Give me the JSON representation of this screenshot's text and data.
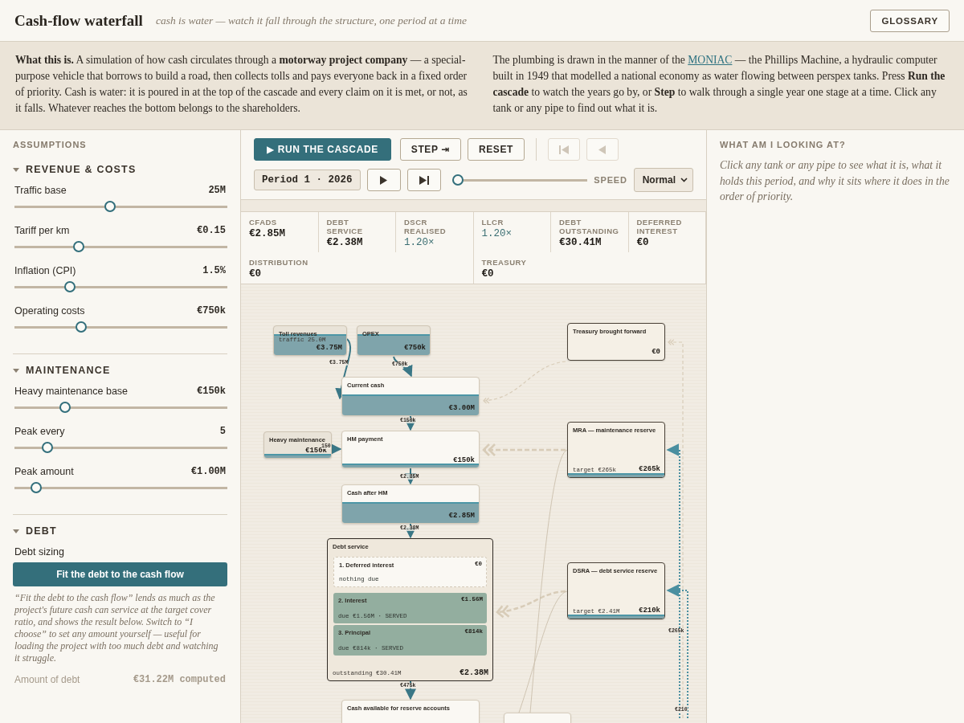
{
  "header": {
    "title": "Cash-flow waterfall",
    "subtitle": "cash is water — watch it fall through the structure, one period at a time",
    "button": "GLOSSARY"
  },
  "intro": {
    "left": "**What this is.** A simulation of how cash circulates through a **motorway project company** — a special-purpose vehicle that borrows to build a road, then collects tolls and pays everyone back in a fixed order of priority. Cash is water: it is poured in at the top of the cascade and every claim on it is met, or not, as it falls. Whatever reaches the bottom belongs to the shareholders.",
    "right_before": "The plumbing is drawn in the manner of the",
    "right_link": "MONIAC",
    "right_after": "— the Phillips Machine, a hydraulic computer built in 1949 that modelled a national economy as water flowing between perspex tanks. Press **Run the cascade** to watch the years go by, or **Step** to walk through a single year one stage at a time. Click any tank or any pipe to find out what it is."
  },
  "sidebar": {
    "title": "ASSUMPTIONS",
    "sections": [
      {
        "title": "REVENUE & COSTS",
        "expanded": true,
        "sliders": [
          {
            "label": "Traffic base",
            "reading": "25M",
            "level": 0.45
          },
          {
            "label": "Tariff per km",
            "reading": "€0.15",
            "level": 0.3
          },
          {
            "label": "Inflation (CPI)",
            "reading": "1.5%",
            "level": 0.26
          },
          {
            "label": "Operating costs",
            "reading": "€750k",
            "level": 0.315
          }
        ]
      },
      {
        "title": "MAINTENANCE",
        "expanded": true,
        "sliders": [
          {
            "label": "Heavy maintenance base",
            "reading": "€150k",
            "level": 0.237
          },
          {
            "label": "Peak every",
            "reading": "5",
            "level": 0.155
          },
          {
            "label": "Peak amount",
            "reading": "€1.00M",
            "level": 0.1
          }
        ]
      },
      {
        "title": "DEBT",
        "expanded": true,
        "field_label": "Debt sizing",
        "button": "Fit the debt to the cash flow",
        "note": "“Fit the debt to the cash flow” lends as much as the project's future cash can service at the target cover ratio, and shows the result below. Switch to “I choose” to set any amount yourself — useful for loading the project with too much debt and watching it struggle.",
        "amount": {
          "label": "Amount of debt",
          "value": "€31.22M computed",
          "disabled": true
        }
      }
    ]
  },
  "controls": {
    "buttons": [
      {
        "label": "▶ RUN THE CASCADE",
        "kind": "primary"
      },
      {
        "label": "STEP ⇥",
        "kind": "plain"
      },
      {
        "label": "RESET",
        "kind": "plain"
      }
    ],
    "nav": [
      {
        "kind": "first",
        "disabled": true
      },
      {
        "kind": "back",
        "disabled": true
      }
    ],
    "period": "Period 1 · 2026",
    "player": [
      {
        "kind": "play",
        "disabled": false
      },
      {
        "kind": "end",
        "disabled": false
      }
    ],
    "timeline": {
      "level": 0
    },
    "speed_label": "SPEED",
    "speed": "Normal"
  },
  "metrics": [
    {
      "label": "CFADS",
      "value": "€2.85M",
      "highlight": false
    },
    {
      "label": "DEBT SERVICE",
      "value": "€2.38M",
      "highlight": false
    },
    {
      "label": "DSCR REALISED",
      "value": "1.20×",
      "highlight": true
    },
    {
      "label": "LLCR",
      "value": "1.20×",
      "highlight": true
    },
    {
      "label": "DEBT OUTSTANDING",
      "value": "€30.41M",
      "highlight": false
    },
    {
      "label": "DEFERRED INTEREST",
      "value": "€0",
      "highlight": false
    },
    {
      "label": "DISTRIBUTION",
      "value": "€0",
      "highlight": false
    },
    {
      "label": "TREASURY",
      "value": "€0",
      "highlight": false
    }
  ],
  "diagram": {
    "tanks": [
      {
        "kind": "input",
        "title": "Toll revenues",
        "value": "€3.75M",
        "note": "traffic 25.0M",
        "filled": true,
        "waterline": true
      },
      {
        "kind": "input",
        "title": "OPEX",
        "value": "€750k",
        "filled": true,
        "waterline": true
      },
      {
        "kind": "reserve",
        "title": "Treasury brought forward",
        "value": "€0",
        "filled": false,
        "waterline": false
      },
      {
        "kind": "tank",
        "title": "Current cash",
        "value": "€3.00M",
        "filled": true,
        "waterline": true
      },
      {
        "kind": "input",
        "title": "Heavy maintenance",
        "value": "€150k",
        "filled": false,
        "waterline": true
      },
      {
        "kind": "tank",
        "title": "HM payment",
        "value": "€150k",
        "filled": false,
        "waterline": true
      },
      {
        "kind": "reserve",
        "title": "MRA — maintenance reserve",
        "value": "€265k",
        "note": "target €265k",
        "filled": false,
        "waterline": true
      },
      {
        "kind": "tank",
        "title": "Cash after HM",
        "value": "€2.85M",
        "filled": true,
        "waterline": true
      },
      {
        "kind": "reserve",
        "title": "DSRA — debt service reserve",
        "value": "€210k",
        "note": "target €2.41M",
        "filled": false,
        "waterline": true
      },
      {
        "kind": "tank",
        "title": "Cash available for reserve accounts",
        "filled": false,
        "waterline": false
      },
      {
        "kind": "tank",
        "filled": false,
        "waterline": false
      }
    ],
    "debt_service": {
      "title": "Debt service",
      "outstanding": "outstanding €30.41M",
      "total": "€2.38M",
      "tiers": [
        {
          "title": "1. Deferred interest",
          "value": "€0",
          "note": "nothing due",
          "kind": "empty"
        },
        {
          "title": "2. Interest",
          "value": "€1.56M",
          "note": "due €1.56M · SERVED",
          "kind": "paid"
        },
        {
          "title": "3. Principal",
          "value": "€814k",
          "note": "due €814k · SERVED",
          "kind": "paid"
        }
      ]
    },
    "pipe_labels": [
      "€3.75M",
      "€750k",
      "€150k",
      "150",
      "€2.85M",
      "€2.38M",
      "€475k",
      "€265k",
      "€210"
    ]
  },
  "info": {
    "title": "WHAT AM I LOOKING AT?",
    "text": "Click any tank or any pipe to see what it is, what it holds this period, and why it sits where it does in the order of priority."
  }
}
